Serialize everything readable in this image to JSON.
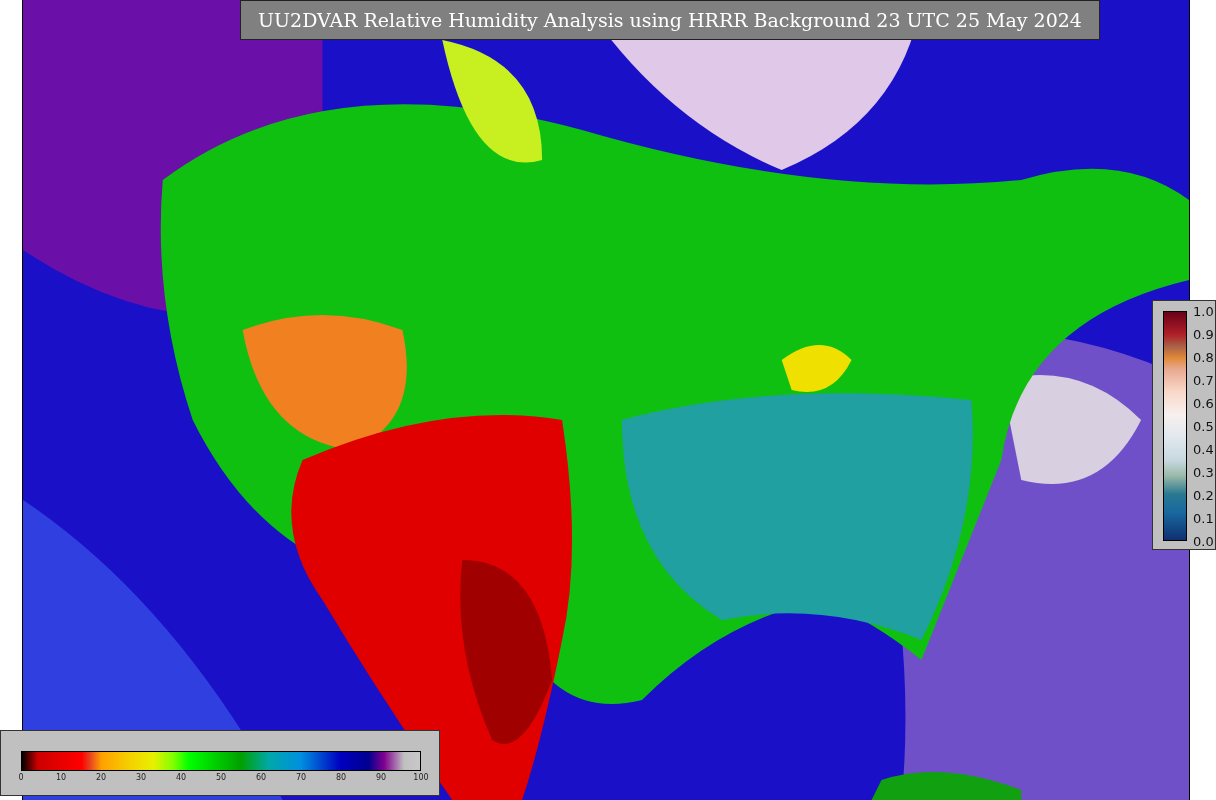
{
  "title": "UU2DVAR Relative Humidity Analysis using HRRR Background 23 UTC 25 May 2024",
  "ratio_legend": {
    "ticks": [
      "1.0",
      "0.9",
      "0.8",
      "0.7",
      "0.6",
      "0.5",
      "0.4",
      "0.3",
      "0.2",
      "0.1",
      "0.0"
    ]
  },
  "humidity_legend": {
    "ticks": [
      "0",
      "10",
      "20",
      "30",
      "40",
      "50",
      "60",
      "70",
      "80",
      "90",
      "100"
    ]
  }
}
